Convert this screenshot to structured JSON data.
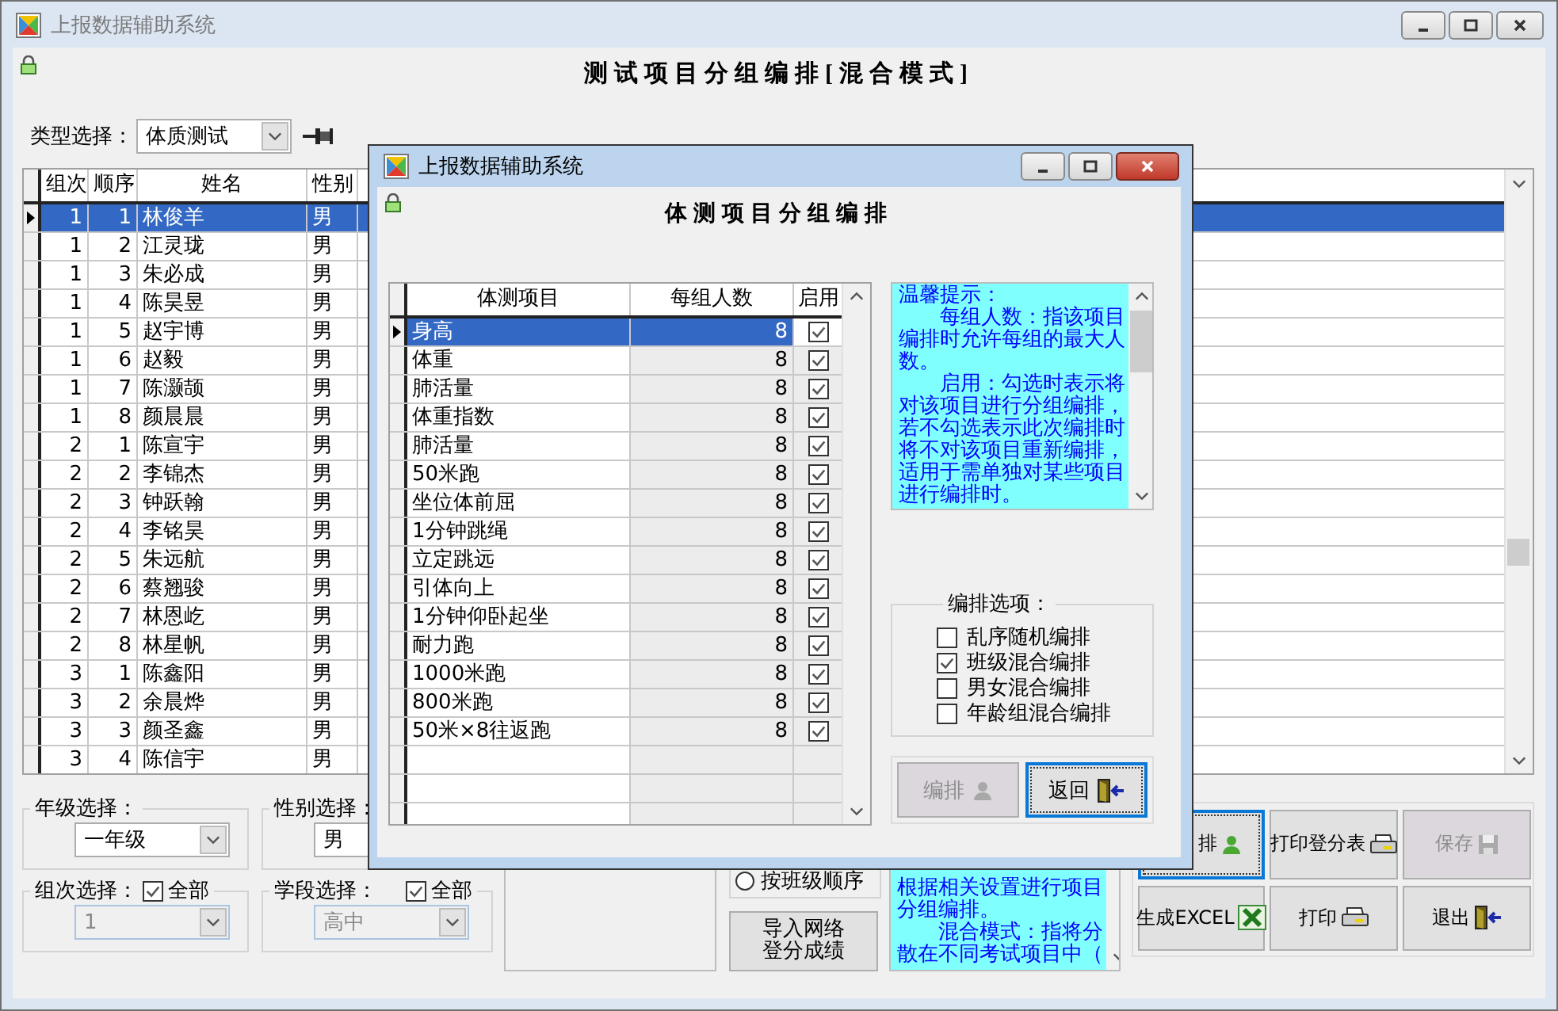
{
  "window": {
    "title": "上报数据辅助系统",
    "heading": "测试项目分组编排[混合模式]"
  },
  "type_select": {
    "label": "类型选择：",
    "value": "体质测试"
  },
  "students": {
    "columns": [
      "组次",
      "顺序",
      "姓名",
      "性别"
    ],
    "rows": [
      {
        "group": "1",
        "order": "1",
        "name": "林俊羊",
        "gender": "男",
        "selected": true
      },
      {
        "group": "1",
        "order": "2",
        "name": "江灵珑",
        "gender": "男",
        "selected": false
      },
      {
        "group": "1",
        "order": "3",
        "name": "朱必成",
        "gender": "男",
        "selected": false
      },
      {
        "group": "1",
        "order": "4",
        "name": "陈昊昱",
        "gender": "男",
        "selected": false
      },
      {
        "group": "1",
        "order": "5",
        "name": "赵宇博",
        "gender": "男",
        "selected": false
      },
      {
        "group": "1",
        "order": "6",
        "name": "赵毅",
        "gender": "男",
        "selected": false
      },
      {
        "group": "1",
        "order": "7",
        "name": "陈灏颉",
        "gender": "男",
        "selected": false
      },
      {
        "group": "1",
        "order": "8",
        "name": "颜晨晨",
        "gender": "男",
        "selected": false
      },
      {
        "group": "2",
        "order": "1",
        "name": "陈宣宇",
        "gender": "男",
        "selected": false
      },
      {
        "group": "2",
        "order": "2",
        "name": "李锦杰",
        "gender": "男",
        "selected": false
      },
      {
        "group": "2",
        "order": "3",
        "name": "钟跃翰",
        "gender": "男",
        "selected": false
      },
      {
        "group": "2",
        "order": "4",
        "name": "李铭昊",
        "gender": "男",
        "selected": false
      },
      {
        "group": "2",
        "order": "5",
        "name": "朱远航",
        "gender": "男",
        "selected": false
      },
      {
        "group": "2",
        "order": "6",
        "name": "蔡翘骏",
        "gender": "男",
        "selected": false
      },
      {
        "group": "2",
        "order": "7",
        "name": "林恩屹",
        "gender": "男",
        "selected": false
      },
      {
        "group": "2",
        "order": "8",
        "name": "林星帆",
        "gender": "男",
        "selected": false
      },
      {
        "group": "3",
        "order": "1",
        "name": "陈鑫阳",
        "gender": "男",
        "selected": false
      },
      {
        "group": "3",
        "order": "2",
        "name": "余晨烨",
        "gender": "男",
        "selected": false
      },
      {
        "group": "3",
        "order": "3",
        "name": "颜圣鑫",
        "gender": "男",
        "selected": false
      },
      {
        "group": "3",
        "order": "4",
        "name": "陈信宇",
        "gender": "男",
        "selected": false
      }
    ]
  },
  "grade": {
    "label": "年级选择：",
    "value": "一年级"
  },
  "gender": {
    "label": "性别选择：",
    "value": "男"
  },
  "group_select": {
    "label": "组次选择：",
    "all_label": "全部",
    "all_checked": true,
    "value": "1",
    "disabled": true
  },
  "stage_select": {
    "label": "学段选择：",
    "all_label": "全部",
    "all_checked": true,
    "value": "高中",
    "disabled": true
  },
  "order_radio": {
    "label": "按班级顺序",
    "selected": false
  },
  "import_button": "导入网络登分成绩",
  "hint": [
    "根据相关设置进行项目分组编排。",
    "　　混合模式：指将分散在不同考试项目中（"
  ],
  "actions": [
    {
      "label": "排",
      "kind": "person",
      "disabled": false,
      "focused": true
    },
    {
      "label": "打印登分表",
      "kind": "printer",
      "disabled": false,
      "focused": false
    },
    {
      "label": "保存",
      "kind": "disk",
      "disabled": true,
      "focused": false
    },
    {
      "label": "生成EXCEL",
      "kind": "excel",
      "disabled": false,
      "focused": false
    },
    {
      "label": "打印",
      "kind": "printer",
      "disabled": false,
      "focused": false
    },
    {
      "label": "退出",
      "kind": "exit",
      "disabled": false,
      "focused": false
    }
  ],
  "dialog": {
    "title": "上报数据辅助系统",
    "heading": "体测项目分组编排",
    "columns": [
      "体测项目",
      "每组人数",
      "启用"
    ],
    "items": [
      {
        "name": "身高",
        "count": "8",
        "enabled": true,
        "selected": true
      },
      {
        "name": "体重",
        "count": "8",
        "enabled": true,
        "selected": false
      },
      {
        "name": "肺活量",
        "count": "8",
        "enabled": true,
        "selected": false
      },
      {
        "name": "体重指数",
        "count": "8",
        "enabled": true,
        "selected": false
      },
      {
        "name": "肺活量",
        "count": "8",
        "enabled": true,
        "selected": false
      },
      {
        "name": "50米跑",
        "count": "8",
        "enabled": true,
        "selected": false
      },
      {
        "name": "坐位体前屈",
        "count": "8",
        "enabled": true,
        "selected": false
      },
      {
        "name": "1分钟跳绳",
        "count": "8",
        "enabled": true,
        "selected": false
      },
      {
        "name": "立定跳远",
        "count": "8",
        "enabled": true,
        "selected": false
      },
      {
        "name": "引体向上",
        "count": "8",
        "enabled": true,
        "selected": false
      },
      {
        "name": "1分钟仰卧起坐",
        "count": "8",
        "enabled": true,
        "selected": false
      },
      {
        "name": "耐力跑",
        "count": "8",
        "enabled": true,
        "selected": false
      },
      {
        "name": "1000米跑",
        "count": "8",
        "enabled": true,
        "selected": false
      },
      {
        "name": "800米跑",
        "count": "8",
        "enabled": true,
        "selected": false
      },
      {
        "name": "50米×8往返跑",
        "count": "8",
        "enabled": true,
        "selected": false
      }
    ],
    "hint": [
      "温馨提示：",
      "　　每组人数：指该项目编排时允许每组的最大人数。",
      "　　启用：勾选时表示将对该项目进行分组编排，若不勾选表示此次编排时将不对该项目重新编排，适用于需单独对某些项目进行编排时。"
    ],
    "options": {
      "label": "编排选项：",
      "items": [
        {
          "label": "乱序随机编排",
          "checked": false
        },
        {
          "label": "班级混合编排",
          "checked": true
        },
        {
          "label": "男女混合编排",
          "checked": false
        },
        {
          "label": "年龄组混合编排",
          "checked": false
        }
      ]
    },
    "buttons": [
      {
        "label": "编排",
        "kind": "person",
        "disabled": true,
        "focused": false
      },
      {
        "label": "返回",
        "kind": "exit",
        "disabled": false,
        "focused": true
      }
    ]
  }
}
